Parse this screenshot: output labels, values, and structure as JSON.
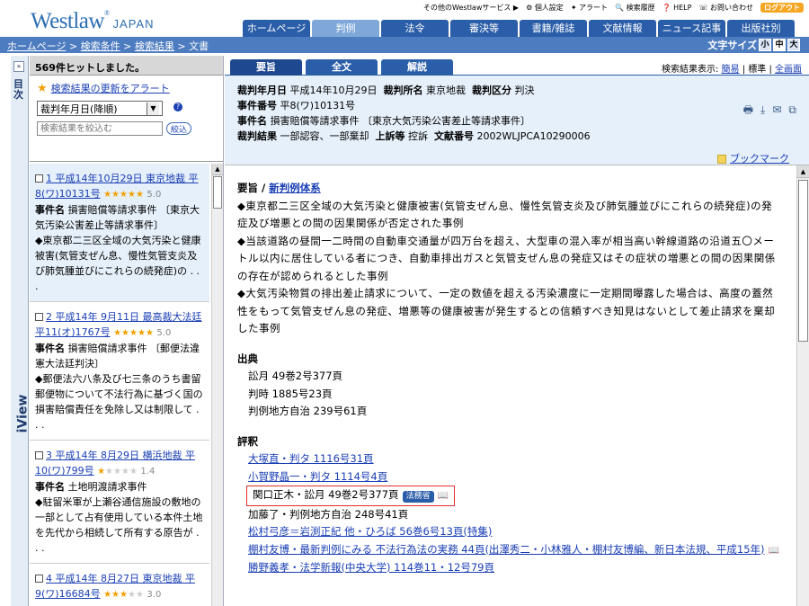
{
  "header": {
    "logo": "Westlaw",
    "logo_mark": "®",
    "logo_suffix": "JAPAN",
    "utility": [
      "その他のWestlawサービス",
      "個人設定",
      "アラート",
      "検索履歴",
      "HELP",
      "お問い合わせ"
    ],
    "logout": "ログアウト"
  },
  "main_tabs": [
    "ホームページ",
    "判例",
    "法令",
    "審決等",
    "書籍/雑誌",
    "文献情報",
    "ニュース記事",
    "出版社別"
  ],
  "breadcrumb": [
    "ホームページ",
    "検索条件",
    "検索結果",
    "文書"
  ],
  "font_size": {
    "label": "文字サイズ",
    "options": [
      "小",
      "中",
      "大"
    ]
  },
  "iview": {
    "expand": "»",
    "toc": "目次",
    "brand": "iView"
  },
  "left": {
    "hits": "569件ヒットしました。",
    "alert": "検索結果の更新をアラート",
    "sort": "裁判年月日(降順)",
    "narrow_placeholder": "検索結果を絞込む",
    "narrow_button": "絞込",
    "results": [
      {
        "link": "1 平成14年10月29日 東京地裁 平8(ワ)10131号",
        "stars": 5,
        "rating": "5.0",
        "label": "事件名",
        "case": "損害賠償等請求事件 〔東京大気汚染公害差止等請求事件〕",
        "summary": "◆東京都二三区全域の大気汚染と健康被害(気管支ぜん息、慢性気管支炎及び肺気腫並びにこれらの続発症)の . . ."
      },
      {
        "link": "2 平成14年 9月11日 最高裁大法廷 平11(オ)1767号",
        "stars": 5,
        "rating": "5.0",
        "label": "事件名",
        "case": "損害賠償請求事件 〔郵便法違憲大法廷判決〕",
        "summary": "◆郵便法六八条及び七三条のうち書留郵便物について不法行為に基づく国の損害賠償責任を免除し又は制限して . . ."
      },
      {
        "link": "3 平成14年 8月29日 横浜地裁 平10(ワ)799号",
        "stars": 1,
        "rating": "1.4",
        "label": "事件名",
        "case": "土地明渡請求事件",
        "summary": "◆駐留米軍が上瀬谷通信施設の敷地の一部として占有使用している本件土地を先代から相続して所有する原告が . . ."
      },
      {
        "link": "4 平成14年 8月27日 東京地裁 平9(ワ)16684号",
        "stars": 3,
        "rating": "3.0",
        "label": "",
        "case": "",
        "summary": ""
      }
    ]
  },
  "right": {
    "tabs": [
      "要旨",
      "全文",
      "解説"
    ],
    "display": {
      "label": "検索結果表示:",
      "opts": [
        "簡易",
        "標準",
        "全画面"
      ]
    },
    "meta": {
      "l1": [
        [
          "裁判年月日",
          "平成14年10月29日"
        ],
        [
          "裁判所名",
          "東京地裁"
        ],
        [
          "裁判区分",
          "判決"
        ]
      ],
      "l2": [
        [
          "事件番号",
          "平8(ワ)10131号"
        ]
      ],
      "l3": [
        [
          "事件名",
          "損害賠償等請求事件 〔東京大気汚染公害差止等請求事件〕"
        ]
      ],
      "l4": [
        [
          "裁判結果",
          "一部認容、一部棄却"
        ],
        [
          "上訴等",
          "控訴"
        ],
        [
          "文献番号",
          "2002WLJPCA10290006"
        ]
      ]
    },
    "bookmark": "ブックマーク",
    "youshi_title": "要旨 /",
    "youshi_link": "新判例体系",
    "paragraphs": [
      "◆東京都二三区全域の大気汚染と健康被害(気管支ぜん息、慢性気管支炎及び肺気腫並びにこれらの続発症)の発症及び増悪との間の因果関係が否定された事例",
      "◆当該道路の昼間一二時間の自動車交通量が四万台を超え、大型車の混入率が相当高い幹線道路の沿道五〇メートル以内に居住している者につき、自動車排出ガスと気管支ぜん息の発症又はその症状の増悪との間の因果関係の存在が認められるとした事例",
      "◆大気汚染物質の排出差止請求について、一定の数値を超える汚染濃度に一定期間曝露した場合は、高度の蓋然性をもって気管支ぜん息の発症、増悪等の健康被害が発生するとの信頼すべき知見はないとして差止請求を棄却した事例"
    ],
    "source_title": "出典",
    "sources": [
      "訟月 49巻2号377頁",
      "判時 1885号23頁",
      "判例地方自治 239号61頁"
    ],
    "review_title": "評釈",
    "reviews": [
      {
        "text": "大塚直・判タ 1116号31頁",
        "link": true
      },
      {
        "text": "小賀野晶一・判タ 1114号4頁",
        "link": true
      },
      {
        "text": "関口正木・訟月 49巻2号377頁",
        "link": false,
        "badge": "法務省",
        "highlight": true
      },
      {
        "text": "加藤了・判例地方自治 248号41頁",
        "link": false
      },
      {
        "text": "松村弓彦＝岩渕正紀 他・ひろば 56巻6号13頁(特集)",
        "link": true
      },
      {
        "text": "棚村友博・最新判例にみる 不法行為法の実務 44頁(出澤秀二・小林雅人・棚村友博編、新日本法規、平成15年)",
        "link": true,
        "book": true
      },
      {
        "text": "勝野義孝・法学新報(中央大学) 114巻11・12号79頁",
        "link": true
      }
    ]
  },
  "colors": {
    "brand": "#2d6fb1",
    "tab": "#2b5ea8",
    "crumb": "#4e7cc0",
    "highlight": "#e03030",
    "star": "#f0a000"
  }
}
